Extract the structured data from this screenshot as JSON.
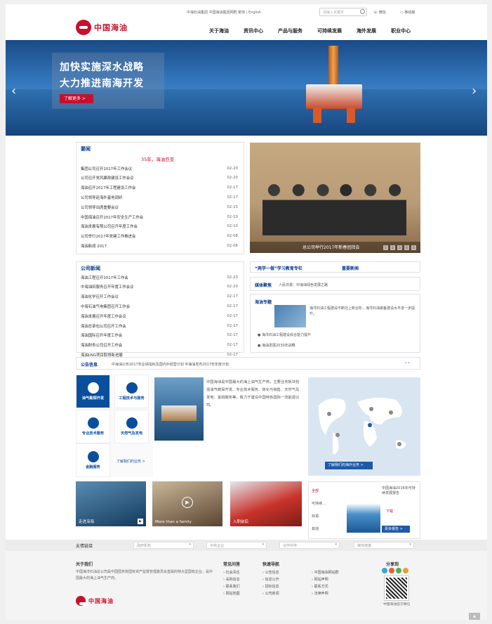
{
  "header": {
    "top_links": "中海石油集团   中国海油集团网群   繁体 | English",
    "search_placeholder": "请输入关键字",
    "wechat": "微信",
    "mobile": "移动版",
    "logo": "中国海油",
    "nav": [
      "关于海油",
      "资讯中心",
      "产品与服务",
      "可持续发展",
      "海外发展",
      "职业中心"
    ]
  },
  "hero": {
    "line1": "加快实施深水战略",
    "line2": "大力推进南海开发",
    "more": "了解更多 >"
  },
  "news": {
    "title": "要闻",
    "headline": "35年，海油巨变",
    "items": [
      {
        "t": "集团公司召开2017年工作会议",
        "d": "02-20"
      },
      {
        "t": "公司召开党风廉政建设工作会议",
        "d": "02-20"
      },
      {
        "t": "海油召开2017年工程建设工作会",
        "d": "02-17"
      },
      {
        "t": "公司领导赴海外基地调研",
        "d": "02-17"
      },
      {
        "t": "公司领导出席重要会议",
        "d": "02-15"
      },
      {
        "t": "中国海油召开2017年安全生产工作会",
        "d": "02-10"
      },
      {
        "t": "海油发展有限公司召开年度工作会",
        "d": "02-10"
      },
      {
        "t": "公司举行2017年党建工作推进会",
        "d": "02-08"
      },
      {
        "t": "海油新闻 2017",
        "d": "02-06"
      }
    ]
  },
  "photo": {
    "caption": "总公司举行2017年新春团拜会",
    "pages": [
      "1",
      "2",
      "3",
      "4",
      "5"
    ]
  },
  "company_news": {
    "title": "公司新闻",
    "items": [
      {
        "t": "海油工程召开2017年工作会",
        "d": "02-20"
      },
      {
        "t": "中海油田服务召开年度工作会议",
        "d": "02-20"
      },
      {
        "t": "海油化学召开工作会议",
        "d": "02-17"
      },
      {
        "t": "中海石油气电集团召开工作会",
        "d": "02-17"
      },
      {
        "t": "海油发展召开年度工作会议",
        "d": "02-17"
      },
      {
        "t": "海油总承包公司召开工作会",
        "d": "02-17"
      },
      {
        "t": "海油国际召开年度工作会",
        "d": "02-17"
      },
      {
        "t": "海油财务公司召开工作会",
        "d": "02-17"
      },
      {
        "t": "海油LNG项目取得新进展",
        "d": "02-17"
      }
    ]
  },
  "topics": {
    "study": "“两学一做”学习教育专栏",
    "special": "重要新闻",
    "media_title": "媒体聚焦",
    "media_line": "人民日报：中海油绿色发展之路",
    "column_title": "海油专题",
    "column_text": "海洋石油工程建设不断迈上新台阶，海洋石油装备建设水平进一步提升。",
    "bullets": [
      "海洋石油工程建设综合能力提升",
      "海油发展2030年战略"
    ]
  },
  "notice": {
    "label": "公告信息",
    "text": "中海油公布2017年业绩指标及国内外经营计划          中海油发布2017年年度计划"
  },
  "services": [
    {
      "label": "油气勘探开发",
      "icon": "oil-drill-icon"
    },
    {
      "label": "工程技术与服务",
      "icon": "gears-icon"
    },
    {
      "label": "专业技术服务",
      "icon": "flask-icon"
    },
    {
      "label": "天然气及发电",
      "icon": "flame-icon"
    },
    {
      "label": "金融服务",
      "icon": "dollar-icon"
    }
  ],
  "services_more": "了解我们的业务 >",
  "business_text": "中国海油是中国最大的海上油气生产商，主要业务板块包括油气勘探开发、专业技术服务、炼化与销售、天然气及发电、金融服务等，致力于建设中国特色国际一流能源公司。",
  "map_button": "了解我们的海外业务 >",
  "thumbs": [
    {
      "label": "走进深海"
    },
    {
      "label": "More than a family"
    },
    {
      "label": "入职前后"
    }
  ],
  "report": {
    "tabs": [
      "全部",
      "可持续发展报告",
      "双语",
      "其他"
    ],
    "title": "中国海油2016年可持续发展报告",
    "download": "下载",
    "more": "更多报告 >"
  },
  "links_bar": {
    "label": "友情链接",
    "selects": [
      "政府机构",
      "中央企业",
      "合作伙伴",
      "媒体链接"
    ]
  },
  "footer": {
    "about_title": "关于我们",
    "about_text": "中国海洋石油总公司是中国国务院国有资产监督管理委员会直属的特大型国有企业，是中国最大的海上油气生产商。",
    "logo": "中国海油",
    "quick_title": "快速导航",
    "visit_title": "常见问答",
    "visit_items": [
      "社会责任",
      "采购信息",
      "联系我们",
      "网站地图"
    ],
    "col2": [
      "公告信息",
      "信息公开",
      "招标信息",
      "公司新闻"
    ],
    "col3": [
      "中国海油网站群",
      "网站声明",
      "联系方式",
      "法律声明"
    ],
    "share_title": "分享到",
    "qr_caption": "中国海油官方微信"
  },
  "colors": {
    "brand": "#c8102e",
    "blue": "#0a4f9e"
  }
}
